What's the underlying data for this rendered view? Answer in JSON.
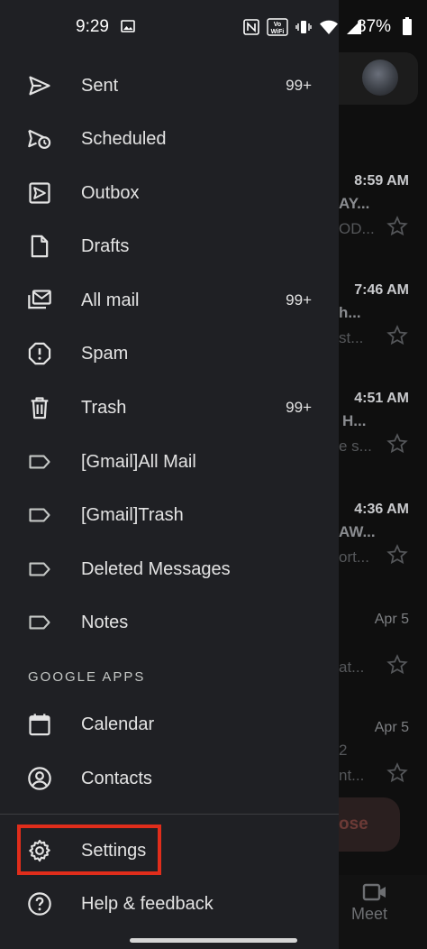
{
  "status_bar": {
    "time": "9:29",
    "battery": "87%",
    "icons": [
      "photo-icon",
      "nfc-icon",
      "vowifi-icon",
      "vibrate-icon",
      "wifi-icon",
      "signal-icon",
      "battery-icon"
    ],
    "vowifi_top": "Vo",
    "vowifi_bottom": "WiFi"
  },
  "drawer": {
    "items": [
      {
        "label": "Sent",
        "count": "99+",
        "icon": "sent-icon"
      },
      {
        "label": "Scheduled",
        "count": "",
        "icon": "scheduled-icon"
      },
      {
        "label": "Outbox",
        "count": "",
        "icon": "outbox-icon"
      },
      {
        "label": "Drafts",
        "count": "",
        "icon": "drafts-icon"
      },
      {
        "label": "All mail",
        "count": "99+",
        "icon": "all-mail-icon"
      },
      {
        "label": "Spam",
        "count": "",
        "icon": "spam-icon"
      },
      {
        "label": "Trash",
        "count": "99+",
        "icon": "trash-icon"
      },
      {
        "label": "[Gmail]All Mail",
        "count": "",
        "icon": "label-icon"
      },
      {
        "label": "[Gmail]Trash",
        "count": "",
        "icon": "label-icon"
      },
      {
        "label": "Deleted Messages",
        "count": "",
        "icon": "label-icon"
      },
      {
        "label": "Notes",
        "count": "",
        "icon": "label-icon"
      }
    ],
    "section_title": "GOOGLE APPS",
    "apps": [
      {
        "label": "Calendar",
        "icon": "calendar-icon"
      },
      {
        "label": "Contacts",
        "icon": "contacts-icon"
      }
    ],
    "settings": {
      "label": "Settings",
      "icon": "gear-icon"
    },
    "help": {
      "label": "Help & feedback",
      "icon": "help-icon"
    }
  },
  "background_inbox": {
    "rows": [
      {
        "time": "8:59 AM",
        "line1": "AY...",
        "line2": "OD..."
      },
      {
        "time": "7:46 AM",
        "line1": "h...",
        "line2": "st..."
      },
      {
        "time": "4:51 AM",
        "line1": "H...",
        "line2": "e s..."
      },
      {
        "time": "4:36 AM",
        "line1": "AW...",
        "line2": "ort..."
      },
      {
        "time": "Apr 5",
        "line1": "",
        "line2": "at..."
      },
      {
        "time": "Apr 5",
        "line1": "2",
        "line2": "nt..."
      }
    ],
    "compose_label": "ose",
    "bottom_nav_label": "Meet"
  },
  "colors": {
    "drawer_bg": "#1f2024",
    "text": "#e3e3e3",
    "highlight_box": "#e02d1b"
  }
}
